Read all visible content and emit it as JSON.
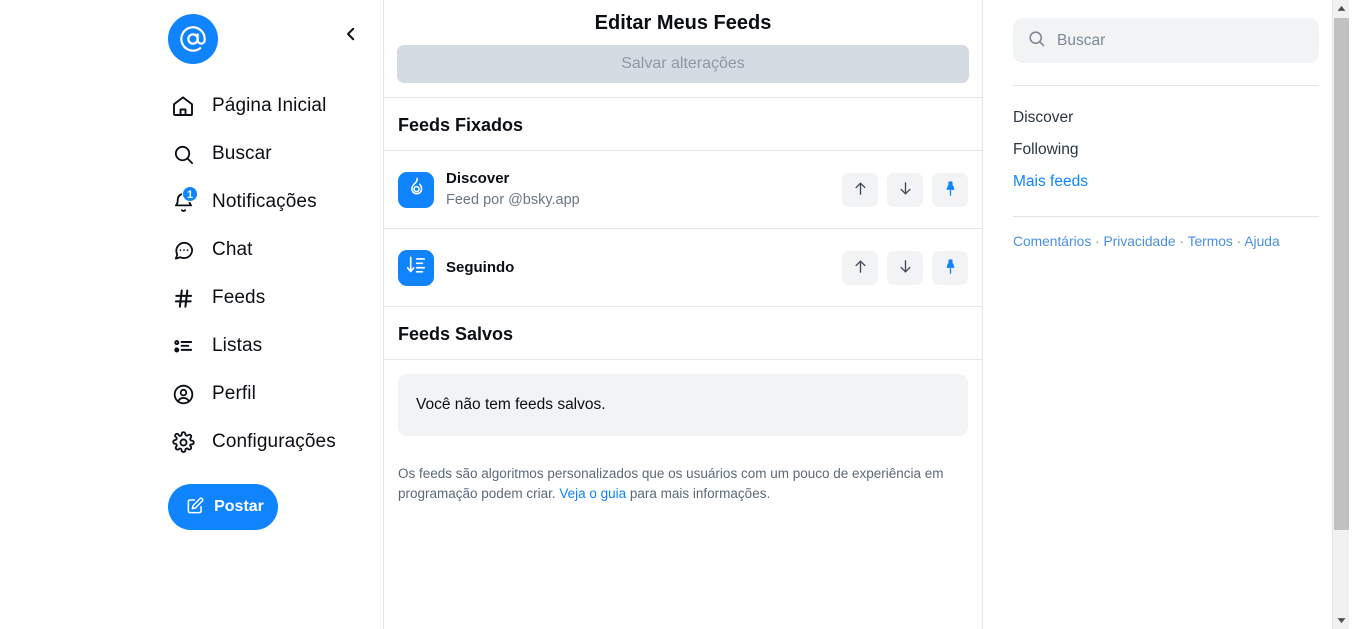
{
  "sidebar": {
    "avatar_icon": "at-sign-avatar",
    "collapse_icon": "chevron-left-icon",
    "items": [
      {
        "label": "Página Inicial",
        "icon": "home-icon"
      },
      {
        "label": "Buscar",
        "icon": "search-icon"
      },
      {
        "label": "Notificações",
        "icon": "bell-icon",
        "badge": "1"
      },
      {
        "label": "Chat",
        "icon": "chat-bubble-icon"
      },
      {
        "label": "Feeds",
        "icon": "hash-icon"
      },
      {
        "label": "Listas",
        "icon": "list-icon"
      },
      {
        "label": "Perfil",
        "icon": "user-circle-icon"
      },
      {
        "label": "Configurações",
        "icon": "gear-icon"
      }
    ],
    "post_button": {
      "label": "Postar",
      "icon": "compose-pencil-icon"
    }
  },
  "main": {
    "title": "Editar Meus Feeds",
    "save_label": "Salvar alterações",
    "pinned_section": "Feeds Fixados",
    "saved_section": "Feeds Salvos",
    "feeds": [
      {
        "name": "Discover",
        "byline": "Feed por @bsky.app",
        "icon": "flame-icon",
        "up_icon": "arrow-up-icon",
        "down_icon": "arrow-down-icon",
        "pin_icon": "pin-icon"
      },
      {
        "name": "Seguindo",
        "byline": "",
        "icon": "sort-descending-icon",
        "up_icon": "arrow-up-icon",
        "down_icon": "arrow-down-icon",
        "pin_icon": "pin-icon"
      }
    ],
    "empty_message": "Você não tem feeds salvos.",
    "note_part1": "Os feeds são algoritmos personalizados que os usuários com um pouco de experiência em programação podem criar. ",
    "note_link": "Veja o guia",
    "note_part2": " para mais informações."
  },
  "rightbar": {
    "search": {
      "placeholder": "Buscar",
      "value": "",
      "icon": "search-icon"
    },
    "links": [
      {
        "label": "Discover",
        "accent": false
      },
      {
        "label": "Following",
        "accent": false
      },
      {
        "label": "Mais feeds",
        "accent": true
      }
    ],
    "footer": {
      "feedback": "Comentários",
      "privacy": "Privacidade",
      "terms": "Termos",
      "help": "Ajuda",
      "separator": " · "
    }
  },
  "colors": {
    "brand": "#1083fe",
    "disabled_button": "#d4dbe3",
    "muted_text": "#6b7785",
    "surface": "#f1f3f5",
    "border": "#e4e7eb"
  }
}
